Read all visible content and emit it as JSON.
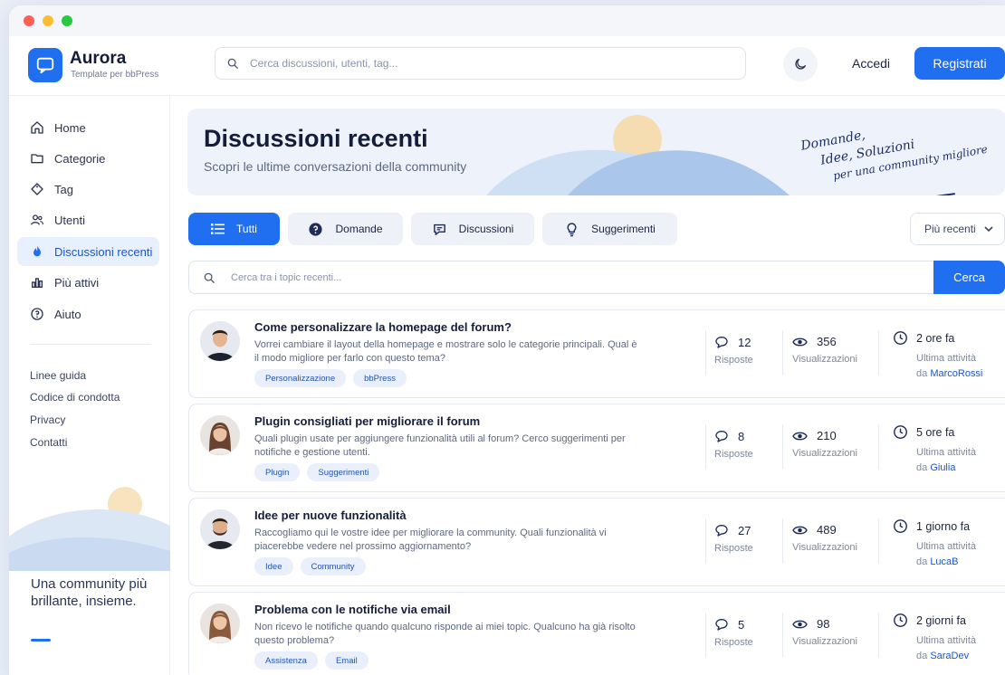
{
  "brand": {
    "name": "Aurora",
    "subtitle": "Template per bbPress"
  },
  "header": {
    "search_placeholder": "Cerca discussioni, utenti, tag...",
    "login_label": "Accedi",
    "register_label": "Registrati"
  },
  "sidebar": {
    "items": [
      {
        "label": "Home",
        "icon": "home-icon"
      },
      {
        "label": "Categorie",
        "icon": "folder-icon"
      },
      {
        "label": "Tag",
        "icon": "tag-icon"
      },
      {
        "label": "Utenti",
        "icon": "users-icon"
      },
      {
        "label": "Discussioni recenti",
        "icon": "flame-icon",
        "active": true
      },
      {
        "label": "Più attivi",
        "icon": "bar-chart-icon"
      },
      {
        "label": "Aiuto",
        "icon": "help-icon"
      }
    ],
    "links": [
      "Linee guida",
      "Codice di condotta",
      "Privacy",
      "Contatti"
    ],
    "slogan": "Una community più brillante, insieme."
  },
  "hero": {
    "title": "Discussioni recenti",
    "subtitle": "Scopri le ultime conversazioni della community",
    "script_line1": "Domande,",
    "script_line2": "Idee, Soluzioni",
    "script_line3": "per una community migliore"
  },
  "filters": [
    {
      "label": "Tutti",
      "icon": "list-icon",
      "active": true
    },
    {
      "label": "Domande",
      "icon": "question-icon"
    },
    {
      "label": "Discussioni",
      "icon": "chat-icon"
    },
    {
      "label": "Suggerimenti",
      "icon": "lightbulb-icon"
    }
  ],
  "sort": {
    "selected": "Più recenti"
  },
  "topic_search": {
    "placeholder": "Cerca tra i topic recenti...",
    "button": "Cerca"
  },
  "stat_labels": {
    "replies": "Risposte",
    "views": "Visualizzazioni",
    "activity": "Ultima attività",
    "by": "da"
  },
  "topics": [
    {
      "title": "Come personalizzare la homepage del forum?",
      "desc": "Vorrei cambiare il layout della homepage e mostrare solo le categorie principali. Qual è il modo migliore per farlo con questo tema?",
      "tags": [
        "Personalizzazione",
        "bbPress"
      ],
      "replies": "12",
      "views": "356",
      "time": "2 ore fa",
      "user": "MarcoRossi"
    },
    {
      "title": "Plugin consigliati per migliorare il forum",
      "desc": "Quali plugin usate per aggiungere funzionalità utili al forum? Cerco suggerimenti per notifiche e gestione utenti.",
      "tags": [
        "Plugin",
        "Suggerimenti"
      ],
      "replies": "8",
      "views": "210",
      "time": "5 ore fa",
      "user": "Giulia"
    },
    {
      "title": "Idee per nuove funzionalità",
      "desc": "Raccogliamo qui le vostre idee per migliorare la community. Quali funzionalità vi piacerebbe vedere nel prossimo aggiornamento?",
      "tags": [
        "Idee",
        "Community"
      ],
      "replies": "27",
      "views": "489",
      "time": "1 giorno fa",
      "user": "LucaB"
    },
    {
      "title": "Problema con le notifiche via email",
      "desc": "Non ricevo le notifiche quando qualcuno risponde ai miei topic. Qualcuno ha già risolto questo problema?",
      "tags": [
        "Assistenza",
        "Email"
      ],
      "replies": "5",
      "views": "98",
      "time": "2 giorni fa",
      "user": "SaraDev"
    }
  ]
}
